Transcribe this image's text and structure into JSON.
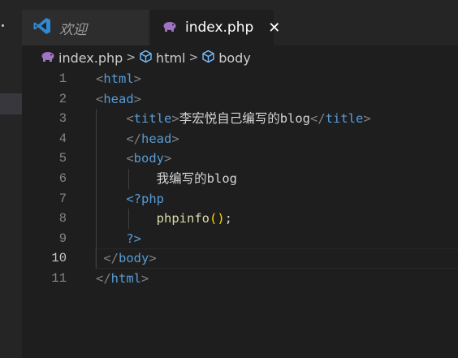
{
  "tabs": {
    "welcome_label": "欢迎",
    "index_label": "index.php",
    "close_symbol": "✕"
  },
  "breadcrumb": {
    "file": "index.php",
    "item1": "html",
    "item2": "body",
    "separator": ">"
  },
  "editor": {
    "active_line": "10",
    "lines": [
      {
        "n": "1",
        "parts": [
          [
            "<",
            "p"
          ],
          [
            "html",
            "t"
          ],
          [
            ">",
            "p"
          ]
        ]
      },
      {
        "n": "2",
        "parts": [
          [
            "<",
            "p"
          ],
          [
            "head",
            "t"
          ],
          [
            ">",
            "p"
          ]
        ]
      },
      {
        "n": "3",
        "parts": [
          [
            "    ",
            "txt"
          ],
          [
            "<",
            "p"
          ],
          [
            "title",
            "t"
          ],
          [
            ">",
            "p"
          ],
          [
            "李宏悦自己编写的blog",
            "txt"
          ],
          [
            "</",
            "p"
          ],
          [
            "title",
            "t"
          ],
          [
            ">",
            "p"
          ]
        ]
      },
      {
        "n": "4",
        "parts": [
          [
            "    ",
            "txt"
          ],
          [
            "</",
            "p"
          ],
          [
            "head",
            "t"
          ],
          [
            ">",
            "p"
          ]
        ]
      },
      {
        "n": "5",
        "parts": [
          [
            "    ",
            "txt"
          ],
          [
            "<",
            "p"
          ],
          [
            "body",
            "t"
          ],
          [
            ">",
            "p"
          ]
        ]
      },
      {
        "n": "6",
        "parts": [
          [
            "        ",
            "txt"
          ],
          [
            "我编写的blog",
            "txt"
          ]
        ]
      },
      {
        "n": "7",
        "parts": [
          [
            "    ",
            "txt"
          ],
          [
            "<?php",
            "t"
          ]
        ]
      },
      {
        "n": "8",
        "parts": [
          [
            "        ",
            "txt"
          ],
          [
            "phpinfo",
            "fn"
          ],
          [
            "(",
            "br"
          ],
          [
            ")",
            "br"
          ],
          [
            ";",
            "txt"
          ]
        ]
      },
      {
        "n": "9",
        "parts": [
          [
            "    ",
            "txt"
          ],
          [
            "?>",
            "t"
          ]
        ]
      },
      {
        "n": "10",
        "parts": [
          [
            " ",
            "txt"
          ],
          [
            "</",
            "p"
          ],
          [
            "body",
            "t"
          ],
          [
            ">",
            "p"
          ]
        ]
      },
      {
        "n": "11",
        "parts": [
          [
            "</",
            "p"
          ],
          [
            "html",
            "t"
          ],
          [
            ">",
            "p"
          ]
        ]
      }
    ]
  },
  "colors": {
    "background": "#1e1e1e",
    "tag": "#569cd6",
    "punctuation": "#808080",
    "function": "#dcdcaa",
    "bracket": "#ffd700"
  }
}
